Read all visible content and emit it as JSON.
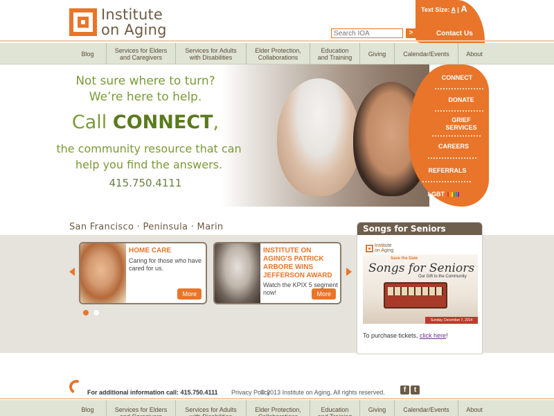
{
  "header": {
    "logo_line1": "Institute",
    "logo_line2": "on Aging",
    "search_placeholder": "Search IOA",
    "search_button": ">",
    "text_size_label": "Text Size:",
    "text_size_small": "A",
    "text_size_sep": "|",
    "text_size_large": "A",
    "contact": "Contact Us"
  },
  "nav": [
    {
      "label": "Blog"
    },
    {
      "label": "Services for Elders\nand Caregivers"
    },
    {
      "label": "Services for Adults\nwith Disabilities"
    },
    {
      "label": "Elder Protection,\nCollaborations"
    },
    {
      "label": "Education\nand Training"
    },
    {
      "label": "Giving"
    },
    {
      "label": "Calendar/Events"
    },
    {
      "label": "About"
    }
  ],
  "hero": {
    "line1": "Not sure where to turn?",
    "line2": "We’re here to help.",
    "line3_pre": "Call ",
    "line3_bold": "CONNECT",
    "line3_post": ",",
    "line4": "the community resource that can",
    "line5": "help you find the answers.",
    "phone": "415.750.4111"
  },
  "side_menu": [
    {
      "label": "CONNECT"
    },
    {
      "label": "DONATE"
    },
    {
      "label": "GRIEF\nSERVICES"
    },
    {
      "label": "CAREERS"
    },
    {
      "label": "REFERRALS"
    },
    {
      "label": "LGBT"
    }
  ],
  "lgbt_colors": [
    "#e53935",
    "#fb8c00",
    "#fdd835",
    "#43a047",
    "#1e88e5",
    "#8e24aa"
  ],
  "location": "San Francisco · Peninsula · Marin",
  "cards": [
    {
      "title": "HOME CARE",
      "text": "Caring for those who have cared for us.",
      "more": "More"
    },
    {
      "title": "INSTITUTE ON AGING'S PATRICK ARBORE WINS JEFFERSON AWARD",
      "text": "Watch the KPIX 5 segment now!",
      "more": "More"
    }
  ],
  "carousel_dots": {
    "active_color": "#e8752a",
    "inactive_color": "#ffffff"
  },
  "songs": {
    "header": "Songs for Seniors",
    "mini_logo_line1": "Institute",
    "mini_logo_line2": "on Aging",
    "save_the_date": "Save the Date",
    "title": "Songs for Seniors",
    "gift": "Our Gift to the Community",
    "date": "Sunday, December 7, 2014",
    "purchase_text": "To purchase tickets, ",
    "purchase_link": "click here",
    "purchase_end": "!"
  },
  "footer": {
    "info": "For additional information call: 415.750.4111",
    "privacy": "Privacy Policy",
    "copyright": "© 2013 Institute on Aging, All rights reserved.",
    "facebook": "f",
    "twitter": "t"
  },
  "colors": {
    "accent": "#e8752a",
    "nav_bg": "#dfe4d4",
    "hero_green": "#7a9a35",
    "brown": "#6e5e4e"
  }
}
